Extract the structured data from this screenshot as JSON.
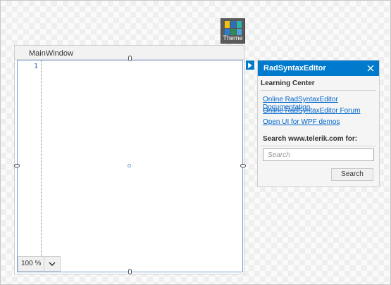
{
  "theme_button": {
    "label": "Theme",
    "icon": "theme-swatches-icon",
    "swatches": [
      "#f1c40f",
      "#2f6db5",
      "#2ab7a9",
      "#2b7cd3",
      "#2e8b57",
      "#4aa3df"
    ]
  },
  "main_window": {
    "title": "MainWindow"
  },
  "editor": {
    "line_numbers": [
      "1"
    ],
    "zoom": {
      "value": "100 %",
      "dropdown_icon": "chevron-down-icon"
    }
  },
  "smart_tag": {
    "toggle_icon": "triangle-right-icon",
    "title": "RadSyntaxEditor",
    "close_icon": "close-icon",
    "learning_center": {
      "title": "Learning Center",
      "links": [
        "Online RadSyntaxEditor Documentation",
        "Online RadSyntaxEditor Forum",
        "Open UI for WPF demos"
      ]
    },
    "search": {
      "title": "Search www.telerik.com for:",
      "placeholder": "Search",
      "value": "",
      "button_label": "Search"
    }
  },
  "colors": {
    "accent": "#007acc",
    "link": "#0066cc",
    "selection": "#7a9fd8"
  }
}
